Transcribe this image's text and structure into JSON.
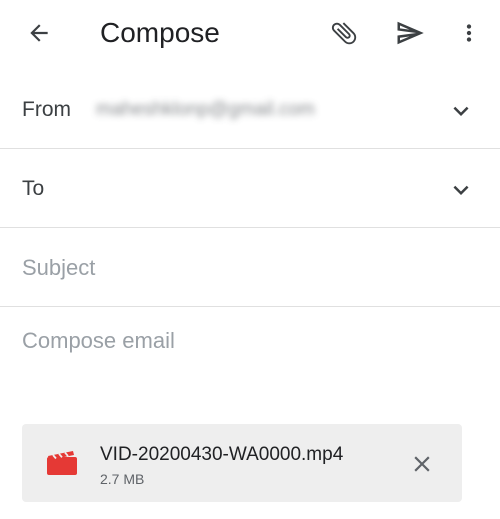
{
  "header": {
    "title": "Compose",
    "back_icon": "arrow-back-icon",
    "attach_icon": "paperclip-icon",
    "send_icon": "send-icon",
    "more_icon": "more-vert-icon"
  },
  "fields": {
    "from_label": "From",
    "from_value": "maheshklonp@gmail.com",
    "to_label": "To",
    "subject_placeholder": "Subject",
    "body_placeholder": "Compose email"
  },
  "attachment": {
    "icon": "video-file-icon",
    "filename": "VID-20200430-WA0000.mp4",
    "size": "2.7 MB",
    "icon_color": "#e53935"
  },
  "colors": {
    "text": "#202124",
    "muted": "#9aa0a6",
    "divider": "#e0e0e0",
    "attachment_bg": "#eeeeee"
  }
}
